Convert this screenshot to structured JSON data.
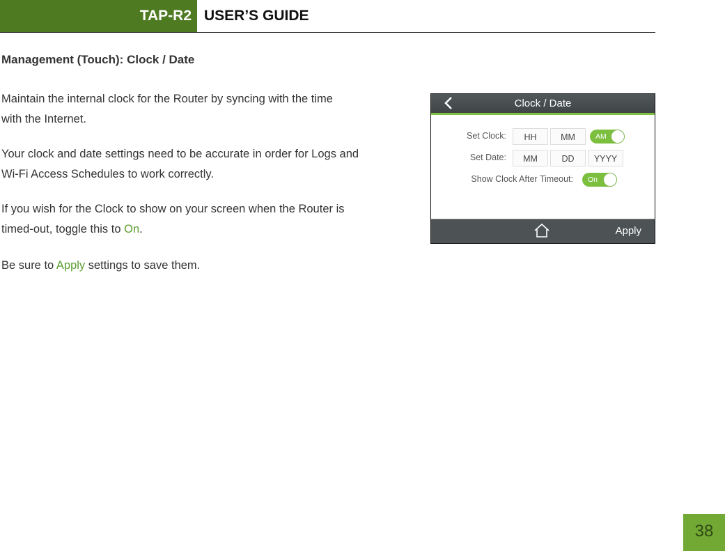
{
  "header": {
    "product_code": "TAP-R2",
    "guide_title": "USER’S GUIDE"
  },
  "section": {
    "title": "Management (Touch): Clock / Date"
  },
  "paragraphs": {
    "p1_line1": "Maintain the internal clock for the Router by syncing with the time",
    "p1_line2": "with the Internet.",
    "p2_line1": "Your clock and date settings need to be accurate in order for Logs and",
    "p2_line2": "Wi-Fi Access Schedules to work correctly.",
    "p3_line1": "If you wish for the Clock to show on your screen when the Router is",
    "p3_line2_before": "timed-out, toggle this to ",
    "p3_highlight": "On",
    "p3_after": ".",
    "p4_before": "Be sure to ",
    "p4_highlight": "Apply",
    "p4_after": " settings to save them."
  },
  "device_screen": {
    "title": "Clock / Date",
    "back_icon": "chevron-left-icon",
    "set_clock_label": "Set Clock:",
    "clock_hour_placeholder": "HH",
    "clock_minute_placeholder": "MM",
    "am_pm_toggle_label": "AM",
    "set_date_label": "Set Date:",
    "date_month_placeholder": "MM",
    "date_day_placeholder": "DD",
    "date_year_placeholder": "YYYY",
    "show_clock_label": "Show Clock After Timeout:",
    "show_clock_toggle_label": "On",
    "home_icon": "home-icon",
    "apply_label": "Apply"
  },
  "colors": {
    "brand_green": "#4e7a21",
    "accent_green": "#7cbf3f",
    "page_number_bg": "#72a934"
  },
  "page_number": "38"
}
